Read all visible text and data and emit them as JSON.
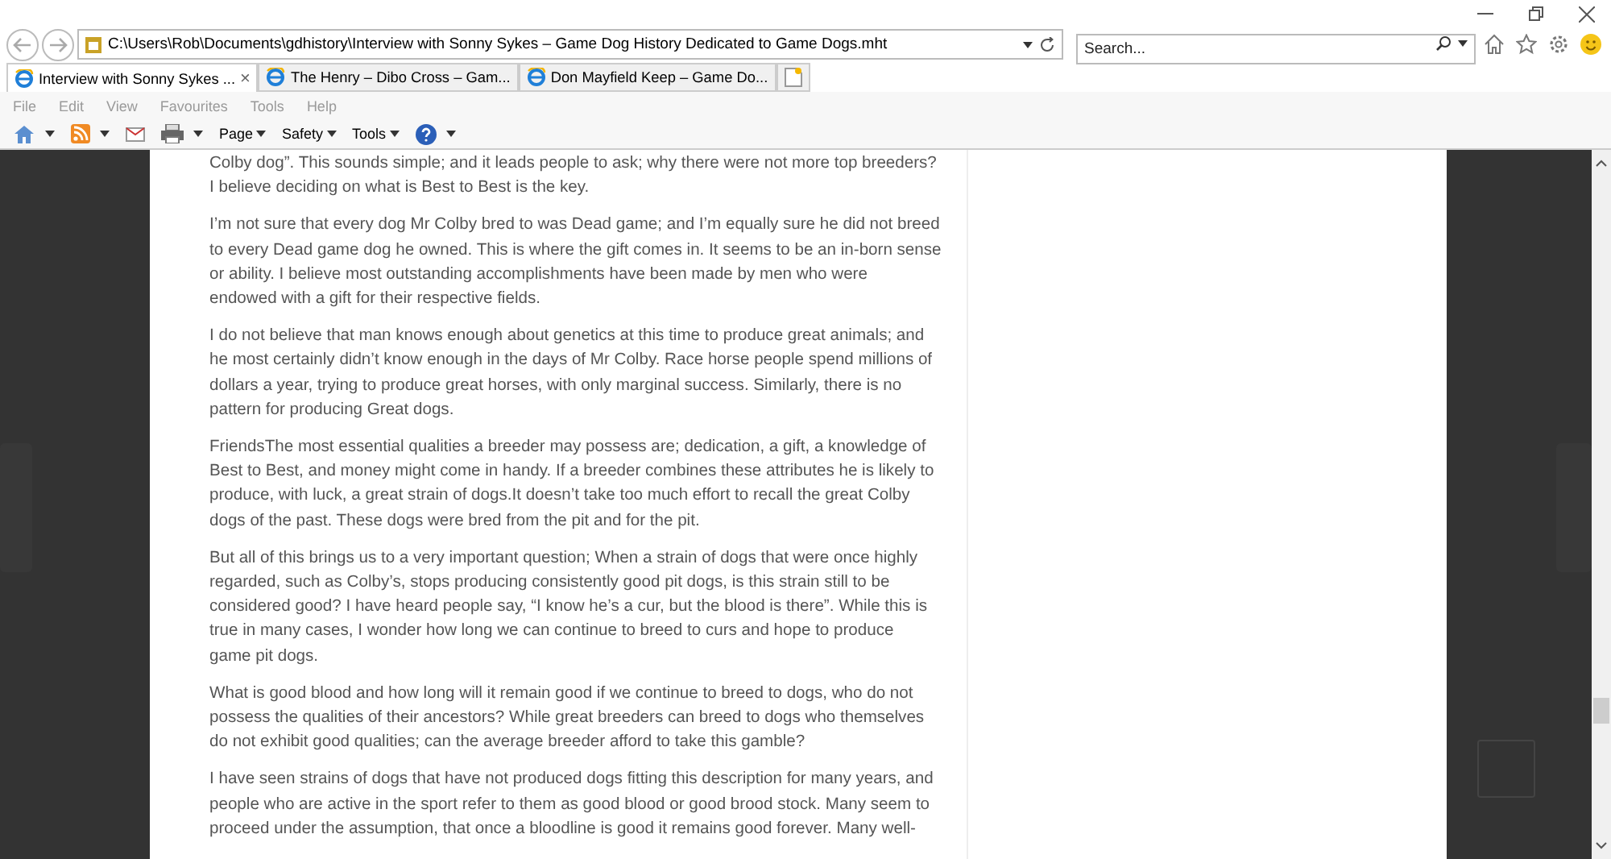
{
  "address_bar": {
    "value": "C:\\Users\\Rob\\Documents\\gdhistory\\Interview with Sonny Sykes – Game Dog History  Dedicated to Game Dogs.mht"
  },
  "search": {
    "placeholder": "Search..."
  },
  "tabs": [
    {
      "label": "Interview with Sonny Sykes ...",
      "selected": true,
      "close": "×"
    },
    {
      "label": "The Henry – Dibo Cross – Gam...",
      "selected": false
    },
    {
      "label": "Don Mayfield Keep – Game Do...",
      "selected": false
    }
  ],
  "menu": [
    {
      "label": "File"
    },
    {
      "label": "Edit"
    },
    {
      "label": "View"
    },
    {
      "label": "Favourites"
    },
    {
      "label": "Tools"
    },
    {
      "label": "Help"
    }
  ],
  "command_bar": [
    {
      "kind": "home"
    },
    {
      "kind": "feed"
    },
    {
      "kind": "mail"
    },
    {
      "kind": "print"
    },
    {
      "kind": "text",
      "label": "Page"
    },
    {
      "kind": "text",
      "label": "Safety"
    },
    {
      "kind": "text",
      "label": "Tools"
    },
    {
      "kind": "help"
    }
  ],
  "article": {
    "paragraphs": [
      [
        "Colby dog”. This sounds simple; and it leads people to ask; why there were not more top breeders?",
        "I believe deciding on what is Best to Best is the key."
      ],
      [
        "I’m not sure that every dog Mr Colby bred to was Dead game; and I’m equally sure he did not breed",
        "to every Dead game dog he owned. This is where the gift comes in. It seems to be an in-born sense",
        "or ability. I believe most outstanding accomplishments have been made by men who were",
        "endowed with a gift for their respective fields."
      ],
      [
        "I do not believe that man knows enough about genetics at this time to produce great animals; and",
        "he most certainly didn’t know enough in the days of Mr Colby. Race horse people spend millions of",
        "dollars a year, trying to produce great horses, with only marginal success. Similarly, there is no",
        "pattern for producing Great dogs."
      ],
      [
        "FriendsThe most essential qualities a breeder may possess are; dedication, a gift, a knowledge of",
        "Best to Best, and money might come in handy. If a breeder combines these attributes he is likely to",
        "produce, with luck, a great strain of dogs.It doesn’t take too much effort to recall the great Colby",
        "dogs of the past. These dogs were bred from the pit and for the pit."
      ],
      [
        "But all of this brings us to a very important question; When a strain of dogs that were once highly",
        "regarded, such as Colby’s, stops producing consistently good pit dogs, is this strain still to be",
        "considered good? I have heard people say, “I know he’s a cur, but the blood is there”. While this is",
        "true in many cases, I wonder how long we can continue to breed to curs and hope to produce",
        "game pit dogs."
      ],
      [
        "What is good blood and how long will it remain good if we continue to breed to dogs, who do not",
        "possess the qualities of their ancestors? While great breeders can breed to dogs who themselves",
        "do not exhibit good qualities; can the average breeder afford to take this gamble?"
      ],
      [
        "I have seen strains of dogs that have not produced dogs fitting this description for many years, and",
        "people who are active in the sport refer to them as good blood or good brood stock. Many seem to",
        "proceed under the assumption, that once a bloodline is good it remains good forever. Many well-"
      ]
    ]
  }
}
